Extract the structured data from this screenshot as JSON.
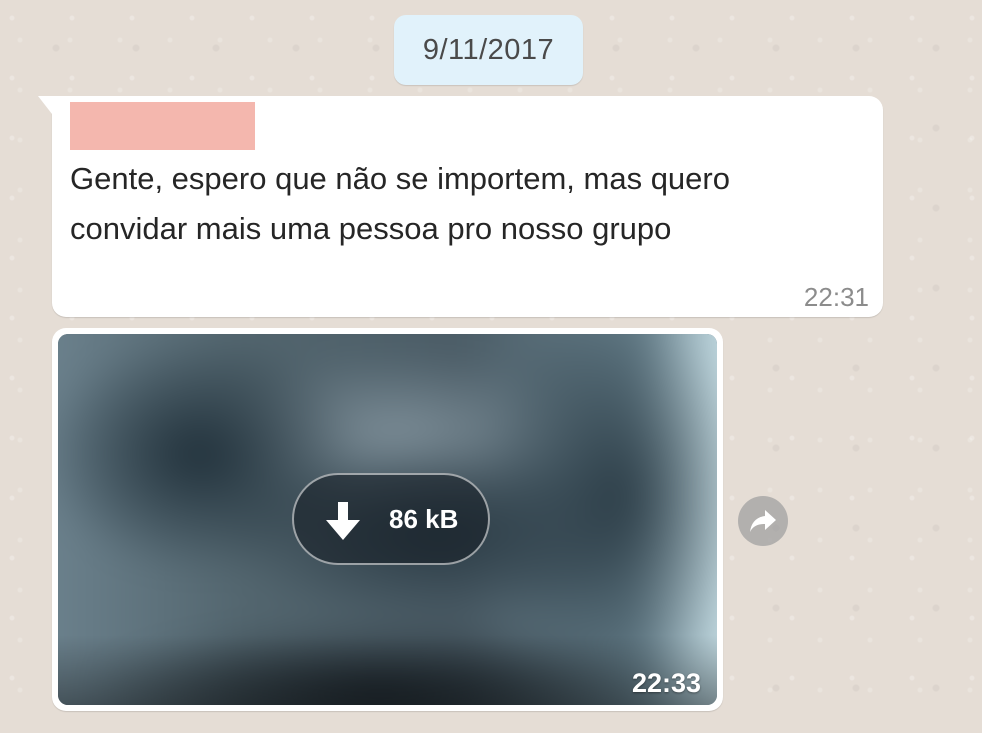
{
  "date_chip": {
    "label": "9/11/2017"
  },
  "message_1": {
    "sender": "[redacted]",
    "text_line_1": "Gente, espero que não se importem, mas quero",
    "text_line_2": "convidar mais uma pessoa pro nosso grupo",
    "time": "22:31"
  },
  "message_2": {
    "type": "image",
    "download_size": "86 kB",
    "time": "22:33",
    "icons": {
      "download": "download-arrow-icon",
      "forward": "forward-icon"
    }
  },
  "colors": {
    "chat_background": "#e5ddd5",
    "date_chip": "#e1f2fb",
    "bubble": "#ffffff",
    "sender_redaction": "#f4b7ae",
    "timestamp": "#8c8c8c"
  }
}
